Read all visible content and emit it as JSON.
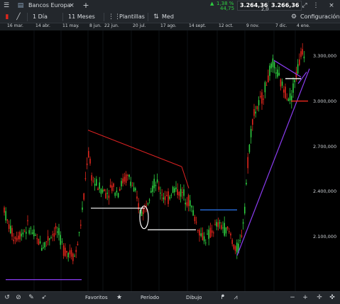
{
  "topbar": {
    "instrument": "Bancos Europa",
    "add_tab": "+",
    "change_pct": "1,38 %",
    "change_abs": "44,75",
    "bid": "3.264,36",
    "spread": "2,00",
    "ask": "3.266,36"
  },
  "toolbar": {
    "interval": "1 Día",
    "range": "11 Meses",
    "templates": "Plantillas",
    "price_type": "Med",
    "settings": "Configuración"
  },
  "time_axis": [
    "16 mar.",
    "14 abr.",
    "11 may.",
    "8 jun.",
    "22 jun.",
    "20 jul.",
    "17 ago.",
    "14 sept.",
    "12 oct.",
    "9 nov.",
    "7 dic.",
    "4 ene."
  ],
  "y_axis": [
    "3.300,000",
    "3.000,000",
    "2.700,000",
    "2.400,000",
    "2.100,000"
  ],
  "chart_data": {
    "type": "candlestick",
    "x_labels": [
      "16 mar.",
      "14 abr.",
      "11 may.",
      "8 jun.",
      "22 jun.",
      "20 jul.",
      "17 ago.",
      "14 sept.",
      "12 oct.",
      "9 nov.",
      "7 dic.",
      "4 ene."
    ],
    "ylim": [
      1830,
      3400
    ],
    "y_ticks": [
      2100,
      2400,
      2700,
      3000,
      3300
    ],
    "up_color": "#2ecc40",
    "down_color": "#e0261c",
    "trendlines": {
      "support_purple": 1900,
      "triangle_top_red": [
        2800,
        2580
      ],
      "white_level_1": 2330,
      "white_level_2": 2200,
      "blue_level": 2320,
      "red_level": 2975,
      "white_level_3": 3110
    }
  },
  "bottombar": {
    "favorites": "Favoritos",
    "period": "Período",
    "drawing": "Dibujo"
  }
}
